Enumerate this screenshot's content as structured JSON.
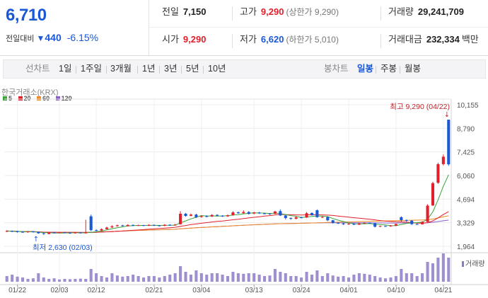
{
  "quote": {
    "price": "6,710",
    "change_label": "전일대비",
    "change_arrow": "▼",
    "change_amount": "440",
    "change_percent": "-6.15%",
    "prev_close_label": "전일",
    "prev_close": "7,150",
    "high_label": "고가",
    "high": "9,290",
    "high_limit": "(상한가 9,290)",
    "volume_label": "거래량",
    "volume": "29,241,709",
    "open_label": "시가",
    "open": "9,290",
    "low_label": "저가",
    "low": "6,620",
    "low_limit": "(하한가 5,010)",
    "amount_label": "거래대금",
    "amount": "232,334",
    "amount_unit": "백만",
    "down_color": "#1a58d6",
    "up_color": "#e0212c"
  },
  "toolbar": {
    "line_chart": "선차트",
    "periods": [
      "1일",
      "1주일",
      "3개월",
      "1년",
      "3년",
      "5년",
      "10년"
    ],
    "candle_chart": "봉차트",
    "candles": [
      "일봉",
      "주봉",
      "월봉"
    ],
    "active_candle": "일봉"
  },
  "chart_meta": {
    "exchange": "한국거래소(KRX)",
    "ma_legend": [
      {
        "label": "5",
        "color": "#3aa33a"
      },
      {
        "label": "20",
        "color": "#e0212c"
      },
      {
        "label": "60",
        "color": "#f08a24"
      },
      {
        "label": "120",
        "color": "#8a5fc8"
      }
    ],
    "high_annotation": "최고 9,290 (04/22)",
    "low_annotation": "최저 2,630 (02/03)",
    "volume_label": "거래량"
  },
  "chart_data": {
    "type": "candlestick",
    "y_ticks": [
      "10,155",
      "8,790",
      "7,425",
      "6,060",
      "4,694",
      "3,329",
      "1,964"
    ],
    "ylim": [
      1964,
      10155
    ],
    "x_ticks": [
      "01/22",
      "02/03",
      "02/12",
      "02/21",
      "03/04",
      "03/13",
      "03/24",
      "04/01",
      "04/10",
      "04/21"
    ],
    "candles": [
      {
        "o": 2810,
        "c": 2850,
        "h": 2900,
        "l": 2780
      },
      {
        "o": 2850,
        "c": 2830,
        "h": 2880,
        "l": 2790
      },
      {
        "o": 2830,
        "c": 2800,
        "h": 2860,
        "l": 2760
      },
      {
        "o": 2800,
        "c": 2780,
        "h": 2840,
        "l": 2750
      },
      {
        "o": 2780,
        "c": 2820,
        "h": 2850,
        "l": 2750
      },
      {
        "o": 2820,
        "c": 2790,
        "h": 2850,
        "l": 2760
      },
      {
        "o": 2790,
        "c": 2720,
        "h": 2820,
        "l": 2690
      },
      {
        "o": 2720,
        "c": 2680,
        "h": 2750,
        "l": 2630
      },
      {
        "o": 2680,
        "c": 2760,
        "h": 2790,
        "l": 2660
      },
      {
        "o": 2760,
        "c": 2740,
        "h": 2800,
        "l": 2710
      },
      {
        "o": 2740,
        "c": 2770,
        "h": 2800,
        "l": 2720
      },
      {
        "o": 2770,
        "c": 2750,
        "h": 2800,
        "l": 2720
      },
      {
        "o": 2750,
        "c": 2720,
        "h": 2780,
        "l": 2690
      },
      {
        "o": 2720,
        "c": 2760,
        "h": 2790,
        "l": 2700
      },
      {
        "o": 2760,
        "c": 2730,
        "h": 2790,
        "l": 2700
      },
      {
        "o": 2730,
        "c": 2760,
        "h": 3500,
        "l": 2700
      },
      {
        "o": 3700,
        "c": 2900,
        "h": 3800,
        "l": 2850
      },
      {
        "o": 2900,
        "c": 2880,
        "h": 2950,
        "l": 2840
      },
      {
        "o": 2880,
        "c": 2960,
        "h": 3000,
        "l": 2860
      },
      {
        "o": 2960,
        "c": 3050,
        "h": 3100,
        "l": 2940
      },
      {
        "o": 3060,
        "c": 3120,
        "h": 3180,
        "l": 3030
      },
      {
        "o": 3130,
        "c": 3180,
        "h": 3220,
        "l": 3100
      },
      {
        "o": 3180,
        "c": 3140,
        "h": 3210,
        "l": 3110
      },
      {
        "o": 3140,
        "c": 3200,
        "h": 3240,
        "l": 3120
      },
      {
        "o": 3200,
        "c": 3160,
        "h": 3230,
        "l": 3130
      },
      {
        "o": 3160,
        "c": 3190,
        "h": 3220,
        "l": 3140
      },
      {
        "o": 3190,
        "c": 3160,
        "h": 3210,
        "l": 3130
      },
      {
        "o": 3160,
        "c": 3200,
        "h": 3240,
        "l": 3140
      },
      {
        "o": 3200,
        "c": 3170,
        "h": 3230,
        "l": 3140
      },
      {
        "o": 3170,
        "c": 3150,
        "h": 3200,
        "l": 3120
      },
      {
        "o": 3150,
        "c": 3210,
        "h": 3250,
        "l": 3130
      },
      {
        "o": 3210,
        "c": 3180,
        "h": 3240,
        "l": 3150
      },
      {
        "o": 3180,
        "c": 3220,
        "h": 3260,
        "l": 3160
      },
      {
        "o": 3240,
        "c": 3850,
        "h": 4000,
        "l": 3220
      },
      {
        "o": 3850,
        "c": 3720,
        "h": 3900,
        "l": 3680
      },
      {
        "o": 3730,
        "c": 3800,
        "h": 3860,
        "l": 3700
      },
      {
        "o": 3800,
        "c": 3650,
        "h": 3850,
        "l": 3600
      },
      {
        "o": 3660,
        "c": 3710,
        "h": 3750,
        "l": 3620
      },
      {
        "o": 3710,
        "c": 3690,
        "h": 3760,
        "l": 3650
      },
      {
        "o": 3690,
        "c": 3780,
        "h": 3820,
        "l": 3660
      },
      {
        "o": 3780,
        "c": 3730,
        "h": 3820,
        "l": 3700
      },
      {
        "o": 3730,
        "c": 3700,
        "h": 3770,
        "l": 3670
      },
      {
        "o": 3700,
        "c": 3760,
        "h": 3800,
        "l": 3670
      },
      {
        "o": 3760,
        "c": 3930,
        "h": 4000,
        "l": 3740
      },
      {
        "o": 3930,
        "c": 3880,
        "h": 3980,
        "l": 3850
      },
      {
        "o": 3880,
        "c": 3950,
        "h": 4050,
        "l": 3860
      },
      {
        "o": 3950,
        "c": 3840,
        "h": 4000,
        "l": 3800
      },
      {
        "o": 3860,
        "c": 3920,
        "h": 3960,
        "l": 3820
      },
      {
        "o": 3920,
        "c": 3870,
        "h": 3950,
        "l": 3840
      },
      {
        "o": 3870,
        "c": 3860,
        "h": 3900,
        "l": 3820
      },
      {
        "o": 3860,
        "c": 3820,
        "h": 3890,
        "l": 3780
      },
      {
        "o": 3850,
        "c": 3980,
        "h": 4020,
        "l": 3830
      },
      {
        "o": 4000,
        "c": 3750,
        "h": 4100,
        "l": 3720
      },
      {
        "o": 3750,
        "c": 3600,
        "h": 3780,
        "l": 3520
      },
      {
        "o": 3600,
        "c": 3560,
        "h": 3640,
        "l": 3500
      },
      {
        "o": 3560,
        "c": 3640,
        "h": 3690,
        "l": 3530
      },
      {
        "o": 3640,
        "c": 3620,
        "h": 3680,
        "l": 3580
      },
      {
        "o": 3630,
        "c": 3880,
        "h": 3950,
        "l": 3610
      },
      {
        "o": 3890,
        "c": 3770,
        "h": 3930,
        "l": 3740
      },
      {
        "o": 4050,
        "c": 3650,
        "h": 4100,
        "l": 3620
      },
      {
        "o": 3650,
        "c": 3660,
        "h": 3700,
        "l": 3600
      },
      {
        "o": 3660,
        "c": 3470,
        "h": 3700,
        "l": 3420
      },
      {
        "o": 3470,
        "c": 3320,
        "h": 3500,
        "l": 3280
      },
      {
        "o": 3320,
        "c": 3290,
        "h": 3360,
        "l": 3260
      },
      {
        "o": 3290,
        "c": 3240,
        "h": 3320,
        "l": 3200
      },
      {
        "o": 3240,
        "c": 3280,
        "h": 3310,
        "l": 3200
      },
      {
        "o": 3280,
        "c": 3220,
        "h": 3300,
        "l": 3190
      },
      {
        "o": 3220,
        "c": 3290,
        "h": 3330,
        "l": 3200
      },
      {
        "o": 3290,
        "c": 3320,
        "h": 3360,
        "l": 3260
      },
      {
        "o": 3320,
        "c": 3300,
        "h": 3350,
        "l": 3270
      },
      {
        "o": 3300,
        "c": 3100,
        "h": 3310,
        "l": 3060
      },
      {
        "o": 3100,
        "c": 3140,
        "h": 3170,
        "l": 3080
      },
      {
        "o": 3140,
        "c": 3120,
        "h": 3160,
        "l": 3090
      },
      {
        "o": 3120,
        "c": 3160,
        "h": 3190,
        "l": 3100
      },
      {
        "o": 3160,
        "c": 3250,
        "h": 3280,
        "l": 3140
      },
      {
        "o": 3650,
        "c": 3480,
        "h": 3700,
        "l": 3400
      },
      {
        "o": 3480,
        "c": 3450,
        "h": 3520,
        "l": 3400
      },
      {
        "o": 3450,
        "c": 3250,
        "h": 3480,
        "l": 3200
      },
      {
        "o": 3250,
        "c": 3240,
        "h": 3300,
        "l": 3210
      },
      {
        "o": 3240,
        "c": 3380,
        "h": 3420,
        "l": 3220
      },
      {
        "o": 3380,
        "c": 4320,
        "h": 4400,
        "l": 3360
      },
      {
        "o": 4330,
        "c": 5620,
        "h": 5700,
        "l": 4300
      },
      {
        "o": 5640,
        "c": 6720,
        "h": 6800,
        "l": 5580
      },
      {
        "o": 6720,
        "c": 7150,
        "h": 7280,
        "l": 6650
      },
      {
        "o": 9290,
        "c": 6710,
        "h": 9290,
        "l": 6620
      }
    ],
    "volumes": [
      0.2,
      0.25,
      0.18,
      0.15,
      0.1,
      0.12,
      0.3,
      0.15,
      0.1,
      0.12,
      0.08,
      0.1,
      0.09,
      0.1,
      0.11,
      0.1,
      0.45,
      0.3,
      0.2,
      0.15,
      0.3,
      0.22,
      0.18,
      0.2,
      0.25,
      0.2,
      0.15,
      0.2,
      0.2,
      0.15,
      0.2,
      0.25,
      0.3,
      0.55,
      0.35,
      0.25,
      0.4,
      0.3,
      0.25,
      0.3,
      0.3,
      0.25,
      0.2,
      0.35,
      0.3,
      0.28,
      0.3,
      0.3,
      0.25,
      0.2,
      0.22,
      0.45,
      0.35,
      0.3,
      0.2,
      0.2,
      0.15,
      0.35,
      0.25,
      0.4,
      0.2,
      0.3,
      0.22,
      0.18,
      0.2,
      0.15,
      0.25,
      0.3,
      0.28,
      0.25,
      0.2,
      0.15,
      0.12,
      0.15,
      0.2,
      0.45,
      0.3,
      0.3,
      0.2,
      0.3,
      0.7,
      0.65,
      0.85,
      1.0,
      0.85
    ],
    "ma5_color": "#3aa33a",
    "ma20_color": "#e0212c",
    "ma60_color": "#f08a24",
    "ma120_color": "#8a5fc8"
  }
}
